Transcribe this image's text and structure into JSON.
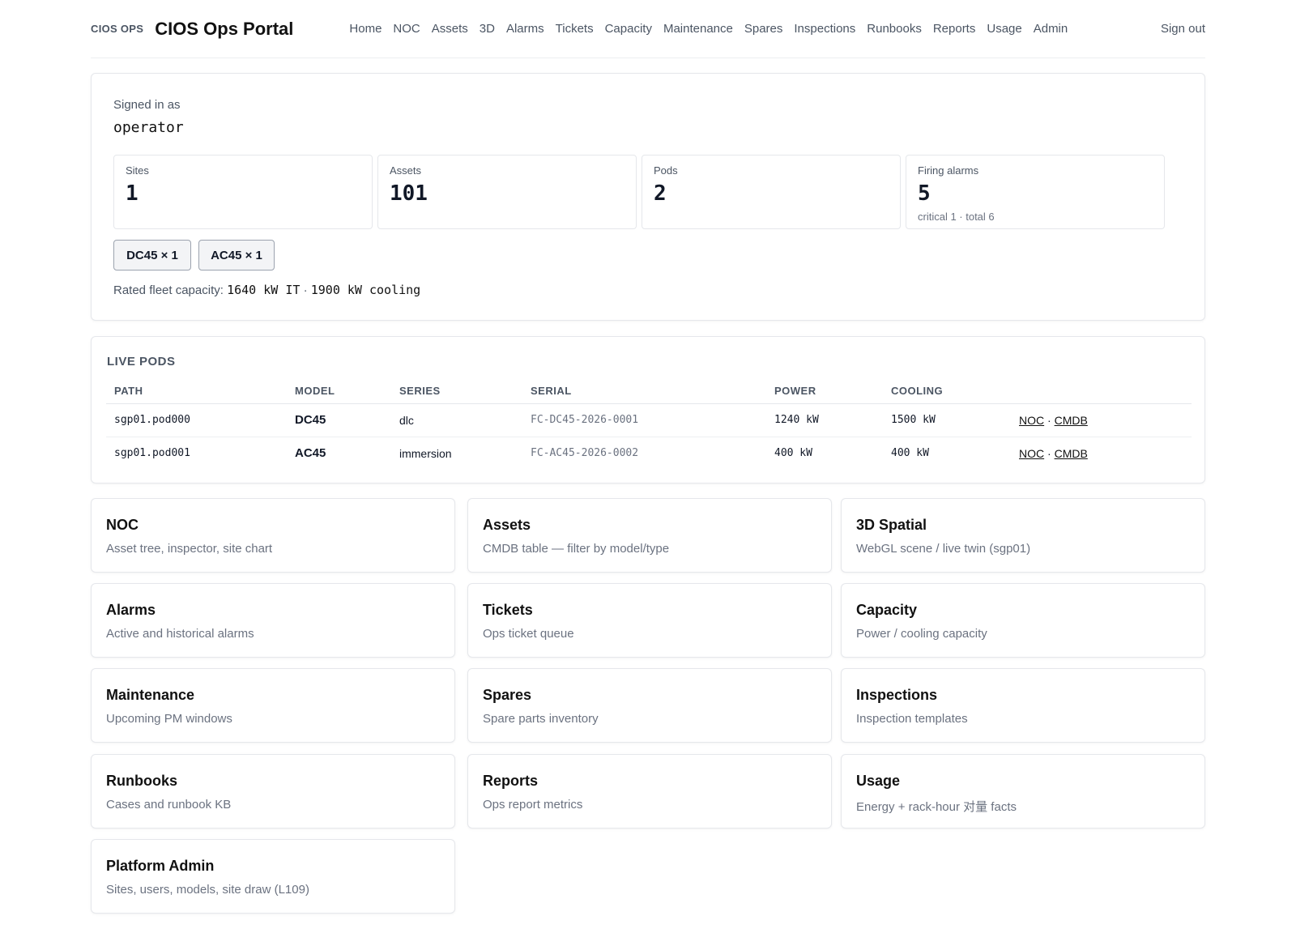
{
  "header": {
    "brand_small": "CIOS OPS",
    "title": "CIOS Ops Portal",
    "nav": [
      "Home",
      "NOC",
      "Assets",
      "3D",
      "Alarms",
      "Tickets",
      "Capacity",
      "Maintenance",
      "Spares",
      "Inspections",
      "Runbooks",
      "Reports",
      "Usage",
      "Admin"
    ],
    "sign_out": "Sign out"
  },
  "summary": {
    "signed_in_label": "Signed in as",
    "username": "operator",
    "stats": [
      {
        "label": "Sites",
        "value": "1",
        "sub": ""
      },
      {
        "label": "Assets",
        "value": "101",
        "sub": ""
      },
      {
        "label": "Pods",
        "value": "2",
        "sub": ""
      },
      {
        "label": "Firing alarms",
        "value": "5",
        "sub": "critical 1 · total 6"
      }
    ],
    "chips": [
      "DC45 × 1",
      "AC45 × 1"
    ],
    "fleet_label": "Rated fleet capacity:",
    "fleet_it": "1640 kW IT",
    "fleet_sep": " · ",
    "fleet_cooling": "1900 kW cooling"
  },
  "live_pods": {
    "title": "LIVE PODS",
    "columns": [
      "PATH",
      "MODEL",
      "SERIES",
      "SERIAL",
      "POWER",
      "COOLING",
      ""
    ],
    "rows": [
      {
        "path": "sgp01.pod000",
        "model": "DC45",
        "series": "dlc",
        "serial": "FC-DC45-2026-0001",
        "power": "1240 kW",
        "cooling": "1500 kW",
        "link1": "NOC",
        "sep": " · ",
        "link2": "CMDB"
      },
      {
        "path": "sgp01.pod001",
        "model": "AC45",
        "series": "immersion",
        "serial": "FC-AC45-2026-0002",
        "power": "400 kW",
        "cooling": "400 kW",
        "link1": "NOC",
        "sep": " · ",
        "link2": "CMDB"
      }
    ]
  },
  "tiles": [
    {
      "title": "NOC",
      "desc": "Asset tree, inspector, site chart"
    },
    {
      "title": "Assets",
      "desc": "CMDB table — filter by model/type"
    },
    {
      "title": "3D Spatial",
      "desc": "WebGL scene / live twin (sgp01)"
    },
    {
      "title": "Alarms",
      "desc": "Active and historical alarms"
    },
    {
      "title": "Tickets",
      "desc": "Ops ticket queue"
    },
    {
      "title": "Capacity",
      "desc": "Power / cooling capacity"
    },
    {
      "title": "Maintenance",
      "desc": "Upcoming PM windows"
    },
    {
      "title": "Spares",
      "desc": "Spare parts inventory"
    },
    {
      "title": "Inspections",
      "desc": "Inspection templates"
    },
    {
      "title": "Runbooks",
      "desc": "Cases and runbook KB"
    },
    {
      "title": "Reports",
      "desc": "Ops report metrics"
    },
    {
      "title": "Usage",
      "desc": "Energy + rack-hour 对量 facts"
    },
    {
      "title": "Platform Admin",
      "desc": "Sites, users, models, site draw (L109)"
    }
  ]
}
